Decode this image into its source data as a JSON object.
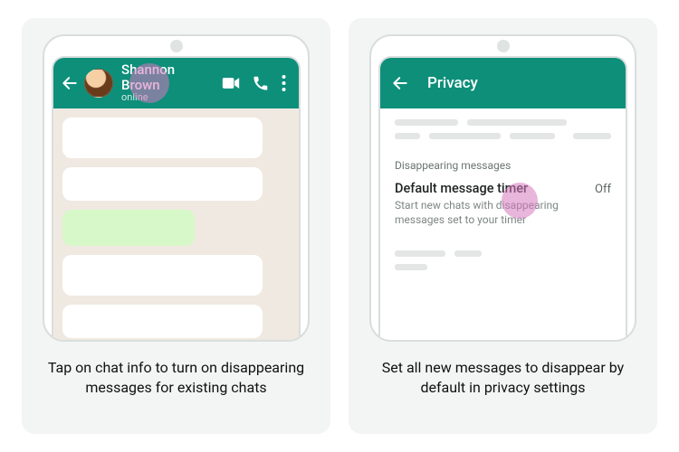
{
  "left": {
    "contact_name": "Shannon Brown",
    "contact_status": "online",
    "caption": "Tap on chat info to turn on disappearing messages for existing chats"
  },
  "right": {
    "appbar_title": "Privacy",
    "section_label": "Disappearing messages",
    "setting_title": "Default message timer",
    "setting_sub": "Start new chats with disappearing messages set to your timer",
    "setting_value": "Off",
    "caption": "Set all new messages to disappear by default in privacy settings"
  },
  "colors": {
    "brand": "#0d8f7a",
    "touch": "#d678be"
  }
}
